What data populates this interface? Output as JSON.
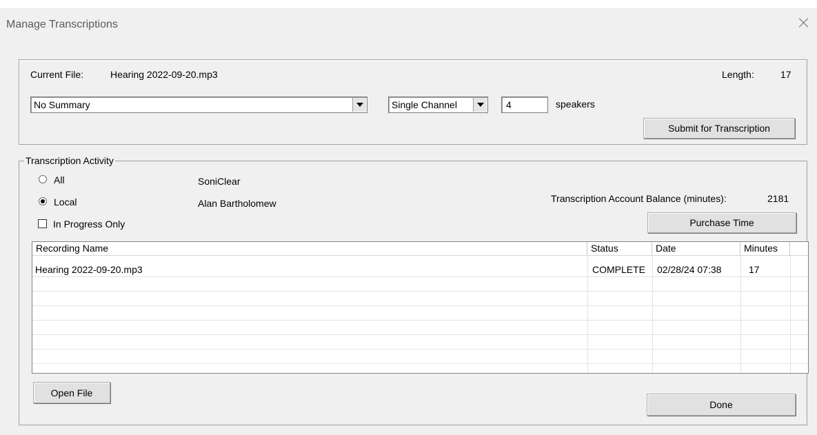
{
  "window": {
    "title": "Manage Transcriptions"
  },
  "current_file": {
    "label": "Current File:",
    "name": "Hearing 2022-09-20.mp3",
    "length_label": "Length:",
    "length_value": "17"
  },
  "summary_select": {
    "value": "No Summary"
  },
  "channel_select": {
    "value": "Single Channel"
  },
  "speakers": {
    "value": "4",
    "label": "speakers"
  },
  "submit_button": "Submit for Transcription",
  "activity": {
    "legend": "Transcription Activity",
    "filter_all": "All",
    "filter_local": "Local",
    "selected_filter": "Local",
    "in_progress_label": "In Progress Only",
    "in_progress_checked": false,
    "company": "SoniClear",
    "user": "Alan Bartholomew",
    "balance_label": "Transcription Account Balance (minutes):",
    "balance_value": "2181",
    "purchase_button": "Purchase Time"
  },
  "table": {
    "columns": [
      "Recording Name",
      "Status",
      "Date",
      "Minutes"
    ],
    "rows": [
      {
        "name": "Hearing 2022-09-20.mp3",
        "status": "COMPLETE",
        "date": "02/28/24 07:38",
        "minutes": "17"
      }
    ]
  },
  "buttons": {
    "open_file": "Open File",
    "done": "Done"
  }
}
